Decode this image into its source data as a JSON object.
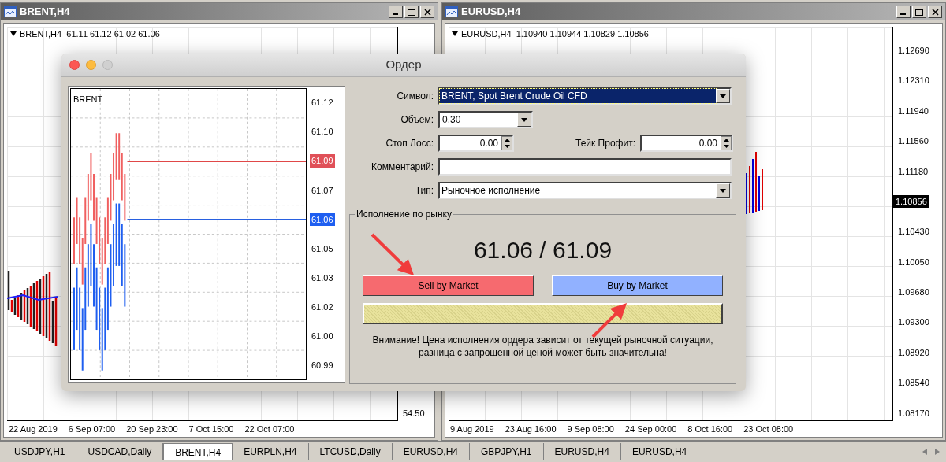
{
  "windows": [
    {
      "title": "BRENT,H4",
      "legend": "BRENT,H4  61.11 61.12 61.02 61.06",
      "price_axis": [
        {
          "label": "54.50",
          "kind": "tick"
        }
      ],
      "time_axis": [
        "22 Aug 2019",
        "6 Sep 07:00",
        "20 Sep 23:00",
        "7 Oct 15:00",
        "22 Oct 07:00"
      ]
    },
    {
      "title": "EURUSD,H4",
      "legend": "EURUSD,H4  1.10940 1.10944 1.10829 1.10856",
      "price_axis": [
        {
          "label": "1.12690",
          "kind": "tick"
        },
        {
          "label": "1.12310",
          "kind": "tick"
        },
        {
          "label": "1.11940",
          "kind": "tick"
        },
        {
          "label": "1.11560",
          "kind": "tick"
        },
        {
          "label": "1.11180",
          "kind": "tick"
        },
        {
          "label": "1.10856",
          "kind": "current"
        },
        {
          "label": "1.10430",
          "kind": "tick"
        },
        {
          "label": "1.10050",
          "kind": "tick"
        },
        {
          "label": "1.09680",
          "kind": "tick"
        },
        {
          "label": "1.09300",
          "kind": "tick"
        },
        {
          "label": "1.08920",
          "kind": "tick"
        },
        {
          "label": "1.08540",
          "kind": "tick"
        },
        {
          "label": "1.08170",
          "kind": "tick"
        }
      ],
      "time_axis": [
        "9 Aug 2019",
        "23 Aug 16:00",
        "9 Sep 08:00",
        "24 Sep 00:00",
        "8 Oct 16:00",
        "23 Oct 08:00"
      ]
    }
  ],
  "dialog": {
    "title": "Ордер",
    "chart": {
      "symbol": "BRENT",
      "price_axis": [
        {
          "label": "61.12",
          "kind": "tick"
        },
        {
          "label": "61.10",
          "kind": "tick"
        },
        {
          "label": "61.09",
          "kind": "ask"
        },
        {
          "label": "61.07",
          "kind": "tick"
        },
        {
          "label": "61.06",
          "kind": "bid"
        },
        {
          "label": "61.05",
          "kind": "tick"
        },
        {
          "label": "61.03",
          "kind": "tick"
        },
        {
          "label": "61.02",
          "kind": "tick"
        },
        {
          "label": "61.00",
          "kind": "tick"
        },
        {
          "label": "60.99",
          "kind": "tick"
        }
      ]
    },
    "rows": [
      {
        "fields": [
          {
            "kind": "select",
            "label": "Символ:",
            "value": "BRENT, Spot Brent Crude Oil CFD",
            "selected": true
          }
        ]
      },
      {
        "fields": [
          {
            "kind": "combo",
            "label": "Объем:",
            "value": "0.30"
          }
        ]
      },
      {
        "fields": [
          {
            "kind": "spin",
            "label": "Стоп Лосс:",
            "value": "0.00"
          },
          {
            "kind": "spin",
            "label": "Тейк Профит:",
            "value": "0.00"
          }
        ]
      },
      {
        "fields": [
          {
            "kind": "text",
            "label": "Комментарий:"
          }
        ]
      },
      {
        "fields": [
          {
            "kind": "select",
            "label": "Тип:",
            "value": "Рыночное исполнение",
            "selected": false
          }
        ]
      }
    ],
    "group": {
      "title": "Исполнение по рынку",
      "quote": "61.06 / 61.09",
      "buttons": [
        {
          "label": "Sell by Market",
          "kind": "sell"
        },
        {
          "label": "Buy by Market",
          "kind": "buy"
        }
      ],
      "warning": [
        "Внимание! Цена исполнения ордера зависит от текущей рыночной ситуации,",
        "разница с запрошенной ценой может быть значительна!"
      ]
    }
  },
  "tabs": [
    {
      "label": "USDJPY,H1",
      "selected": false
    },
    {
      "label": "USDCAD,Daily",
      "selected": false
    },
    {
      "label": "BRENT,H4",
      "selected": true
    },
    {
      "label": "EURPLN,H4",
      "selected": false
    },
    {
      "label": "LTCUSD,Daily",
      "selected": false
    },
    {
      "label": "EURUSD,H4",
      "selected": false
    },
    {
      "label": "GBPJPY,H1",
      "selected": false
    },
    {
      "label": "EURUSD,H4",
      "selected": false
    },
    {
      "label": "EURUSD,H4",
      "selected": false
    }
  ]
}
